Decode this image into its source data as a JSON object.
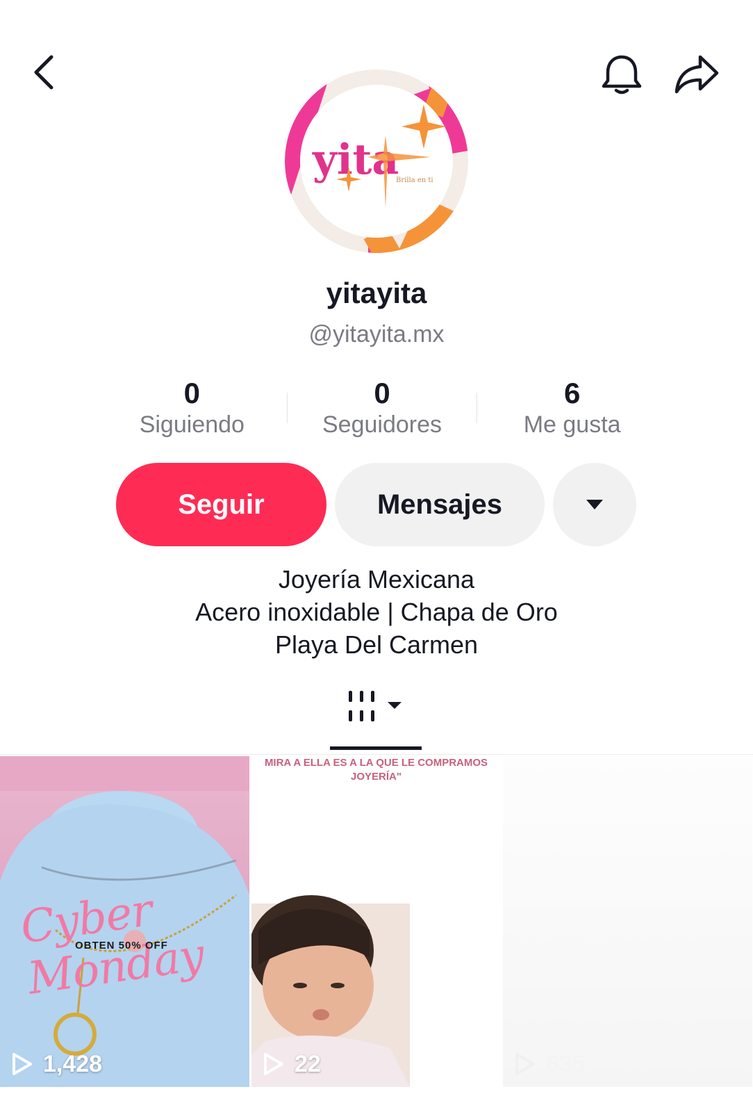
{
  "header": {
    "back_icon": "chevron-left-icon",
    "bell_icon": "bell-icon",
    "share_icon": "share-arrow-icon"
  },
  "profile": {
    "avatar_brand": "yita",
    "avatar_tagline": "Brilla en ti",
    "display_name": "yitayita",
    "username": "@yitayita.mx"
  },
  "stats": [
    {
      "value": "0",
      "label": "Siguiendo"
    },
    {
      "value": "0",
      "label": "Seguidores"
    },
    {
      "value": "6",
      "label": "Me gusta"
    }
  ],
  "actions": {
    "follow_label": "Seguir",
    "message_label": "Mensajes",
    "more_icon": "caret-down-icon"
  },
  "bio": {
    "line1": "Joyería Mexicana",
    "line2": "Acero inoxidable | Chapa de Oro",
    "line3": "Playa Del Carmen"
  },
  "tabs": {
    "active_icon": "video-grid-icon"
  },
  "videos": [
    {
      "views": "1,428",
      "overlay_script": "Cyber Monday",
      "overlay_text": "OBTEN 50% OFF"
    },
    {
      "views": "22",
      "caption": "MIRA A ELLA ES A LA QUE LE COMPRAMOS JOYERÍA\""
    },
    {
      "views": "635"
    }
  ],
  "colors": {
    "accent": "#fe2c55",
    "secondary_button": "#f1f1f2",
    "muted_text": "#7a7b83",
    "primary_text": "#161823"
  }
}
